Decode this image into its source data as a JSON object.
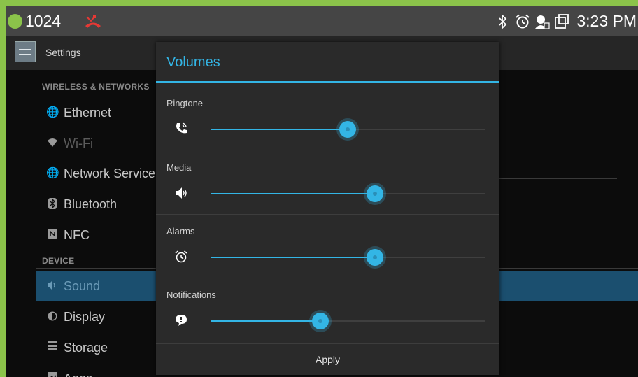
{
  "status_bar": {
    "extension": "1024",
    "time": "3:23 PM",
    "icons": [
      "bluetooth-icon",
      "alarm-icon",
      "account-icon",
      "screenshot-icon"
    ]
  },
  "action_bar": {
    "title": "Settings"
  },
  "settings": {
    "categories": {
      "wireless": "WIRELESS & NETWORKS",
      "device": "DEVICE"
    },
    "items": [
      {
        "label": "Ethernet",
        "icon": "globe-icon"
      },
      {
        "label": "Wi-Fi",
        "icon": "wifi-icon"
      },
      {
        "label": "Network Service",
        "icon": "globe-icon"
      },
      {
        "label": "Bluetooth",
        "icon": "bluetooth-icon"
      },
      {
        "label": "NFC",
        "icon": "nfc-icon"
      },
      {
        "label": "Sound",
        "icon": "speaker-icon",
        "selected": true
      },
      {
        "label": "Display",
        "icon": "brightness-icon"
      },
      {
        "label": "Storage",
        "icon": "storage-icon"
      },
      {
        "label": "Apps",
        "icon": "apps-icon"
      }
    ]
  },
  "dialog": {
    "title": "Volumes",
    "rows": [
      {
        "label": "Ringtone",
        "icon": "ringtone-icon",
        "value": 0.5
      },
      {
        "label": "Media",
        "icon": "media-volume-icon",
        "value": 0.6
      },
      {
        "label": "Alarms",
        "icon": "alarm-icon",
        "value": 0.6
      },
      {
        "label": "Notifications",
        "icon": "notification-icon",
        "value": 0.4
      }
    ],
    "apply_label": "Apply"
  },
  "colors": {
    "accent": "#33b5e5",
    "selected_bg": "#1b4f6f",
    "frame": "#8bc34a",
    "missed_call": "#e53935"
  }
}
